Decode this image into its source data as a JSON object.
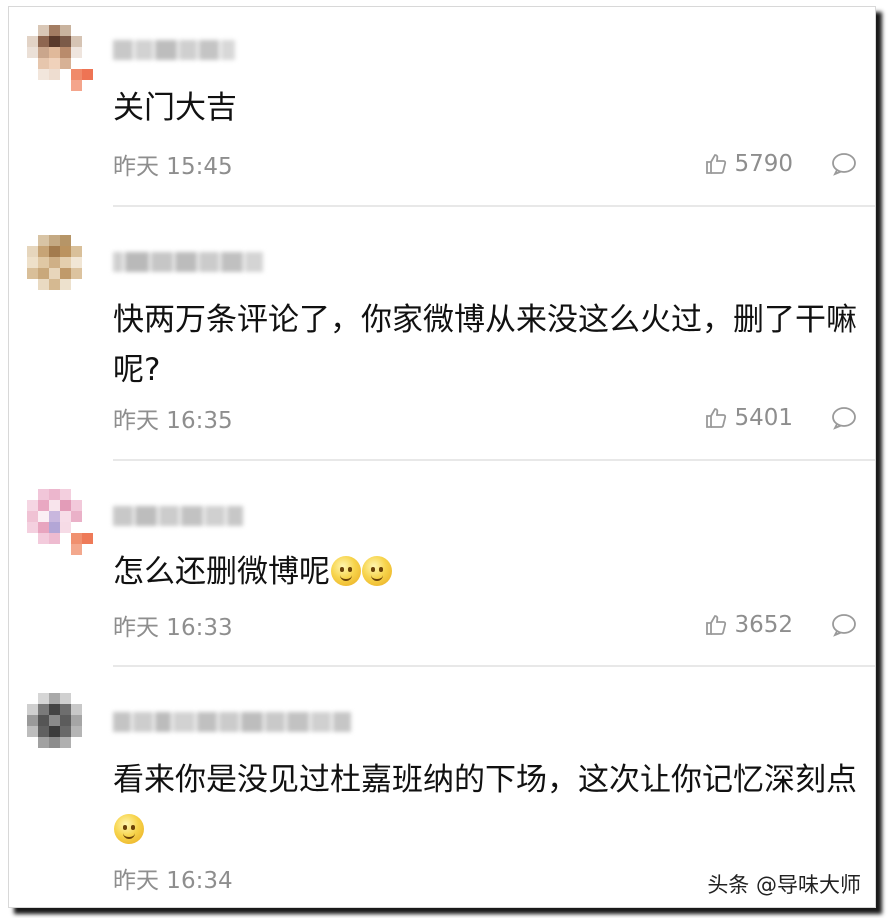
{
  "comments": [
    {
      "content": "关门大吉",
      "time": "昨天 15:45",
      "likes": "5790",
      "emoji_count": 0
    },
    {
      "content": "快两万条评论了，你家微博从来没这么火过，删了干嘛呢?",
      "time": "昨天 16:35",
      "likes": "5401",
      "emoji_count": 0
    },
    {
      "content": "怎么还删微博呢",
      "time": "昨天 16:33",
      "likes": "3652",
      "emoji_count": 2
    },
    {
      "content": "看来你是没见过杜嘉班纳的下场，这次让你记忆深刻点",
      "time": "昨天 16:34",
      "likes": "",
      "emoji_count": 1
    }
  ],
  "icons": {
    "like": "thumbs-up-icon",
    "reply": "comment-bubble-icon",
    "emoji": "smiley-emoji"
  },
  "watermark": "头条 @导味大师",
  "colors": {
    "text": "#111111",
    "meta": "#8e8e8e",
    "divider": "#e8e8e8"
  }
}
